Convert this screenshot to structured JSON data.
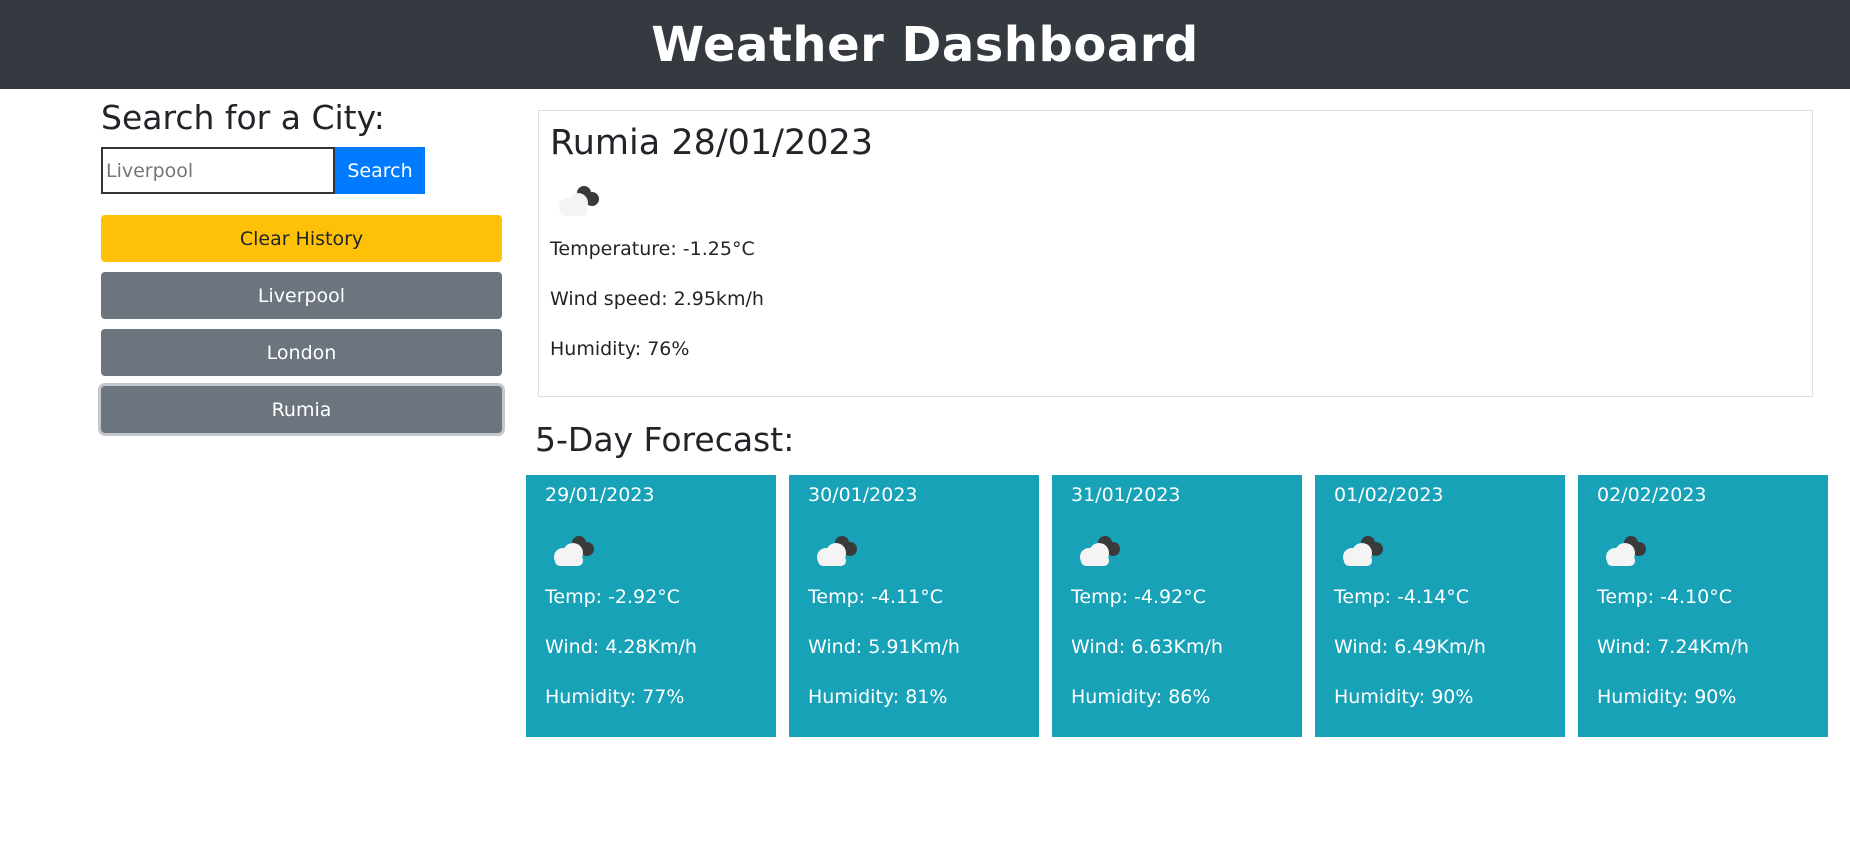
{
  "header": {
    "title": "Weather Dashboard"
  },
  "search": {
    "heading": "Search for a City:",
    "placeholder": "Liverpool",
    "button_label": "Search",
    "clear_label": "Clear History",
    "history": [
      "Liverpool",
      "London",
      "Rumia"
    ],
    "active_history": "Rumia"
  },
  "colors": {
    "header_bg": "#343a40",
    "search_button": "#007bff",
    "clear_button": "#ffc107",
    "history_button": "#6c757d",
    "forecast_card": "#17a2b8"
  },
  "current": {
    "title": "Rumia 28/01/2023",
    "icon": "broken-clouds-icon",
    "temperature": "Temperature: -1.25°C",
    "wind": "Wind speed: 2.95km/h",
    "humidity": "Humidity: 76%"
  },
  "forecast": {
    "title": "5-Day Forecast:",
    "days": [
      {
        "date": "29/01/2023",
        "icon": "broken-clouds-icon",
        "temp": "Temp: -2.92°C",
        "wind": "Wind: 4.28Km/h",
        "humidity": "Humidity: 77%"
      },
      {
        "date": "30/01/2023",
        "icon": "broken-clouds-icon",
        "temp": "Temp: -4.11°C",
        "wind": "Wind: 5.91Km/h",
        "humidity": "Humidity: 81%"
      },
      {
        "date": "31/01/2023",
        "icon": "broken-clouds-icon",
        "temp": "Temp: -4.92°C",
        "wind": "Wind: 6.63Km/h",
        "humidity": "Humidity: 86%"
      },
      {
        "date": "01/02/2023",
        "icon": "broken-clouds-icon",
        "temp": "Temp: -4.14°C",
        "wind": "Wind: 6.49Km/h",
        "humidity": "Humidity: 90%"
      },
      {
        "date": "02/02/2023",
        "icon": "broken-clouds-icon",
        "temp": "Temp: -4.10°C",
        "wind": "Wind: 7.24Km/h",
        "humidity": "Humidity: 90%"
      }
    ]
  }
}
